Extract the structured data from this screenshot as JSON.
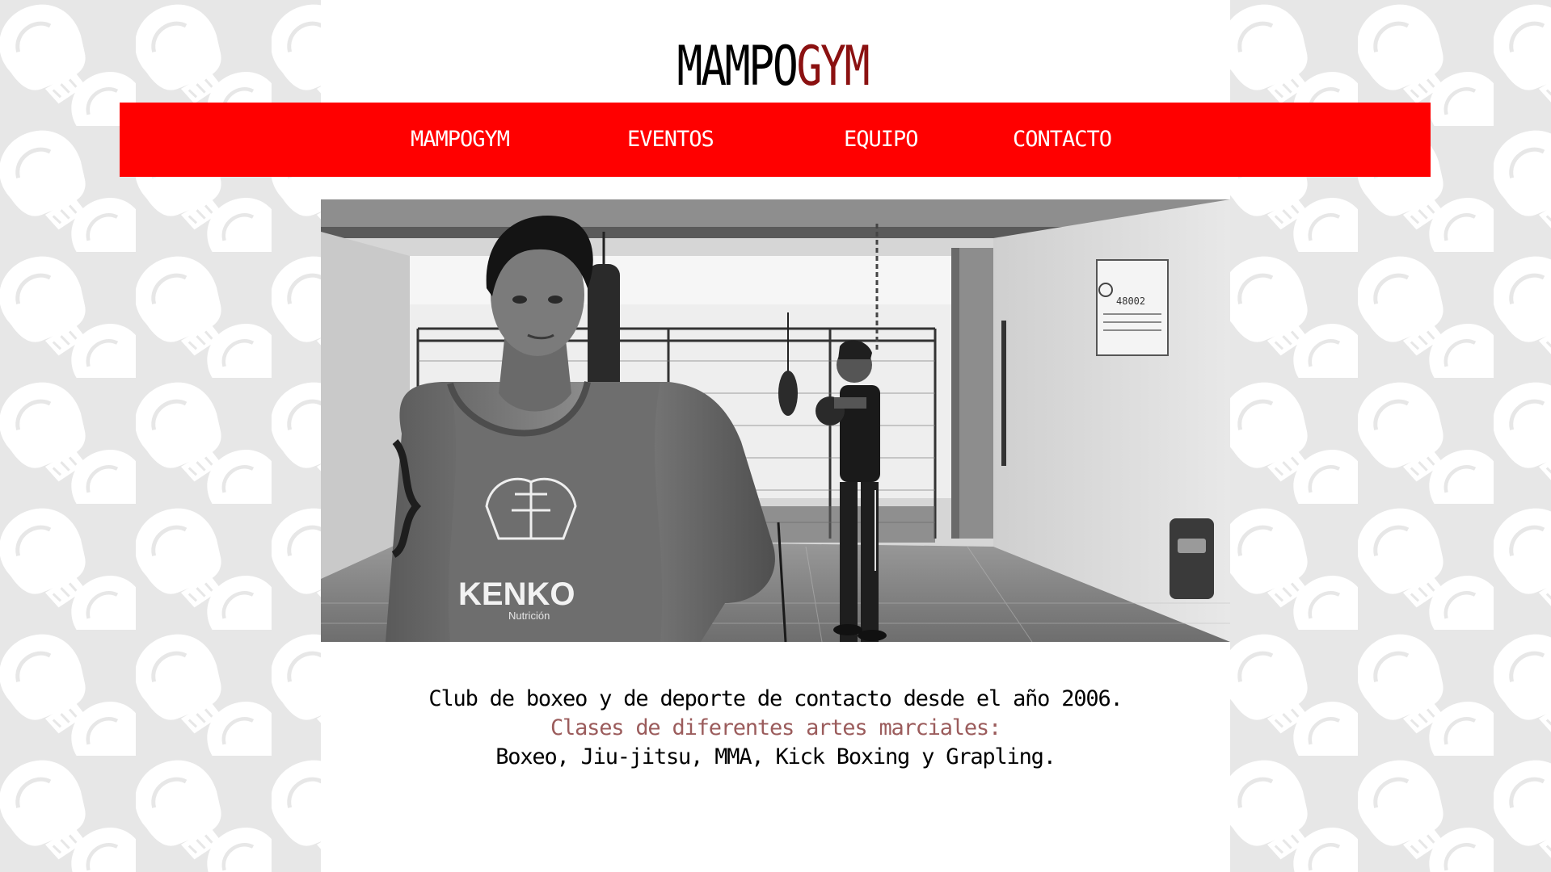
{
  "brand": {
    "logo_part1": "MAMPO",
    "logo_part2": "GYM",
    "logo_part1_color": "#000000",
    "logo_part2_color": "#8b1111"
  },
  "colors": {
    "nav_background": "#ff0000",
    "nav_text": "#ffffff",
    "page_background": "#ffffff",
    "pattern_background": "#e7e7e7",
    "highlight_text": "#9b5c5c"
  },
  "nav": {
    "items": [
      {
        "label": "MAMPOGYM"
      },
      {
        "label": "EVENTOS"
      },
      {
        "label": "EQUIPO"
      },
      {
        "label": "CONTACTO"
      }
    ]
  },
  "hero": {
    "shirt_text": "KENKO",
    "shirt_subtext": "Nutrición",
    "sign_text": "48002",
    "icon": "boxing-gym-photo"
  },
  "intro": {
    "line1": "Club de boxeo y de deporte de contacto desde el año 2006.",
    "line2": "Clases de diferentes artes marciales:",
    "line3": "Boxeo, Jiu-jitsu, MMA, Kick Boxing y Grapling."
  },
  "background": {
    "icon": "boxing-glove-icon"
  }
}
